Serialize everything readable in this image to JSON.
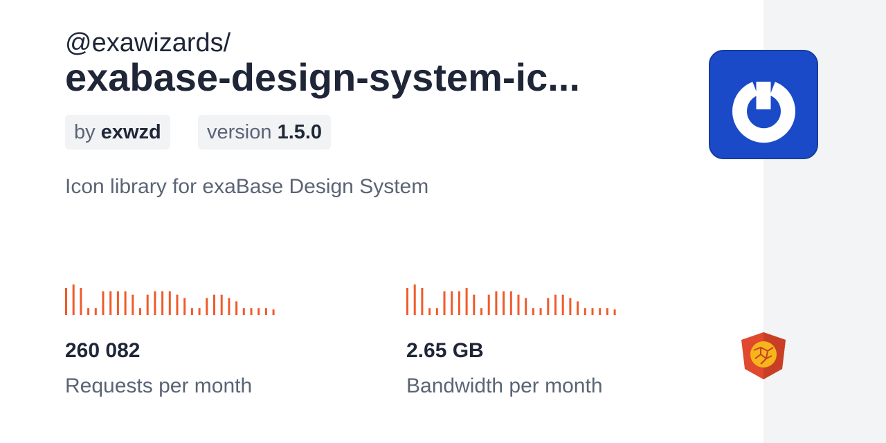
{
  "package": {
    "scope": "@exawizards/",
    "name": "exabase-design-system-ic...",
    "author_prefix": "by",
    "author": "exwzd",
    "version_prefix": "version",
    "version": "1.5.0",
    "description": "Icon library for exaBase Design System"
  },
  "stats": {
    "requests": {
      "value": "260 082",
      "label": "Requests per month"
    },
    "bandwidth": {
      "value": "2.65 GB",
      "label": "Bandwidth per month"
    }
  },
  "chart_data": [
    {
      "type": "bar",
      "values": [
        8,
        9,
        8,
        2,
        2,
        7,
        7,
        7,
        7,
        6,
        2,
        6,
        7,
        7,
        7,
        6,
        5,
        2,
        2,
        5,
        6,
        6,
        5,
        4,
        2,
        2,
        2,
        2,
        1
      ],
      "color": "#f05a2b"
    },
    {
      "type": "bar",
      "values": [
        8,
        9,
        8,
        2,
        2,
        7,
        7,
        7,
        8,
        6,
        2,
        6,
        7,
        7,
        7,
        6,
        5,
        2,
        2,
        5,
        6,
        6,
        5,
        4,
        2,
        2,
        2,
        2,
        1
      ],
      "color": "#f05a2b"
    }
  ],
  "colors": {
    "spark": "#f05a2b",
    "logo_bg": "#1b4ac8",
    "shield": "#e0492e",
    "shield_globe": "#f5b51b"
  },
  "icons": {
    "logo": "power-ring-logo-icon",
    "shield": "jsdelivr-shield-icon"
  }
}
